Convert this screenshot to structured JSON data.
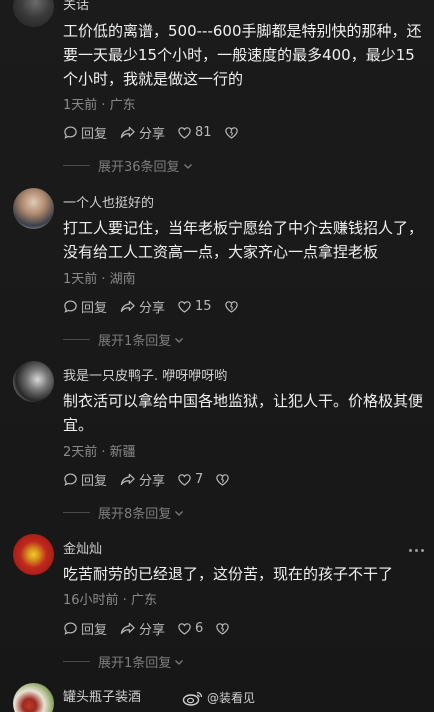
{
  "comments": [
    {
      "username": "关话",
      "body": "工价低的离谱，500---600手脚都是特别快的那种，还要一天最少15个小时，一般速度的最多400，最少15个小时，我就是做这一行的",
      "meta": "1天前 · 广东",
      "reply_label": "回复",
      "share_label": "分享",
      "likes": "81",
      "expand_label": "展开36条回复"
    },
    {
      "username": "一个人也挺好的",
      "body": "打工人要记住，当年老板宁愿给了中介去赚钱招人了，没有给工人工资高一点，大家齐心一点拿捏老板",
      "meta": "1天前 · 湖南",
      "reply_label": "回复",
      "share_label": "分享",
      "likes": "15",
      "expand_label": "展开1条回复"
    },
    {
      "username": "我是一只皮鸭子. 咿呀咿呀哟",
      "body": "制衣活可以拿给中国各地监狱，让犯人干。价格极其便宜。",
      "meta": "2天前 · 新疆",
      "reply_label": "回复",
      "share_label": "分享",
      "likes": "7",
      "expand_label": "展开8条回复"
    },
    {
      "username": "金灿灿",
      "body": "吃苦耐劳的已经退了，这份苦，现在的孩子不干了",
      "meta": "16小时前 · 广东",
      "reply_label": "回复",
      "share_label": "分享",
      "likes": "6",
      "expand_label": "展开1条回复"
    },
    {
      "username": "罐头瓶子装酒"
    }
  ],
  "watermark": "@装看见",
  "colors": {
    "background": "#191919",
    "text": "#f0f0f0",
    "muted": "#8a8a8a"
  }
}
